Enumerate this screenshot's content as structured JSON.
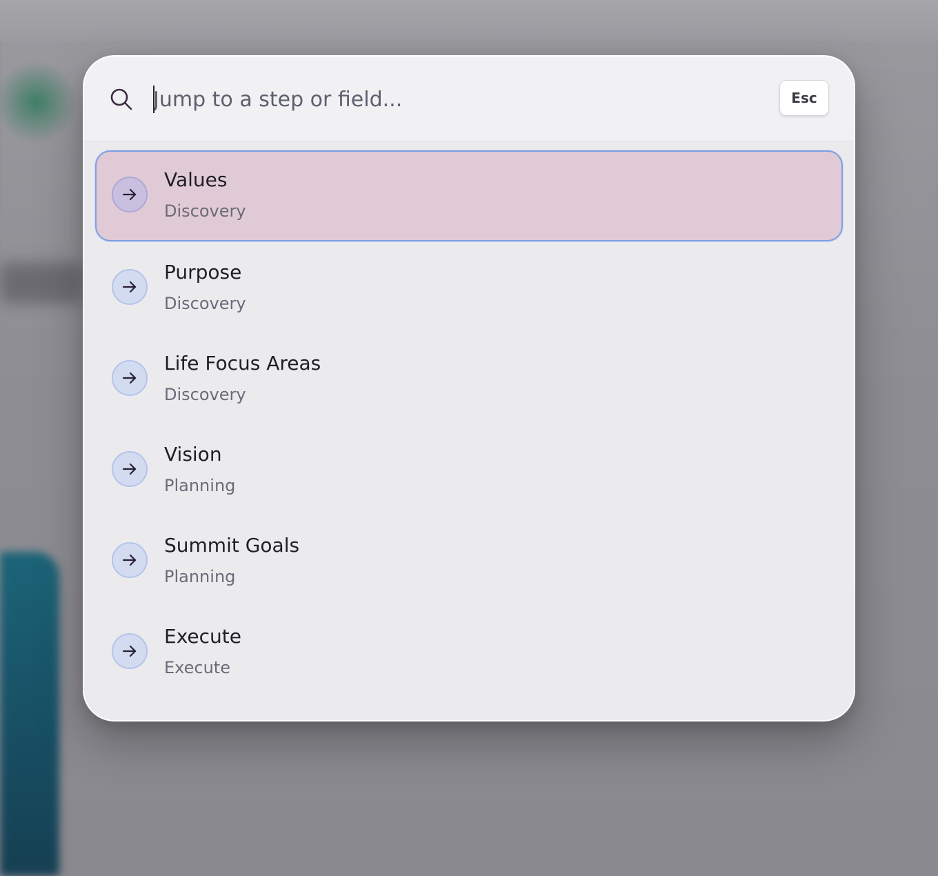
{
  "search": {
    "placeholder": "Jump to a step or field...",
    "value": "",
    "icon": "search-icon",
    "esc_label": "Esc"
  },
  "results": [
    {
      "title": "Values",
      "subtitle": "Discovery",
      "icon": "arrow-right-icon",
      "selected": true
    },
    {
      "title": "Purpose",
      "subtitle": "Discovery",
      "icon": "arrow-right-icon",
      "selected": false
    },
    {
      "title": "Life Focus Areas",
      "subtitle": "Discovery",
      "icon": "arrow-right-icon",
      "selected": false
    },
    {
      "title": "Vision",
      "subtitle": "Planning",
      "icon": "arrow-right-icon",
      "selected": false
    },
    {
      "title": "Summit Goals",
      "subtitle": "Planning",
      "icon": "arrow-right-icon",
      "selected": false
    },
    {
      "title": "Execute",
      "subtitle": "Execute",
      "icon": "arrow-right-icon",
      "selected": false
    }
  ],
  "colors": {
    "selected_background": "#e0cad5",
    "selected_border": "#7f9fe4",
    "icon_circle": "#d3dbf0",
    "panel_background": "#ebebee"
  }
}
